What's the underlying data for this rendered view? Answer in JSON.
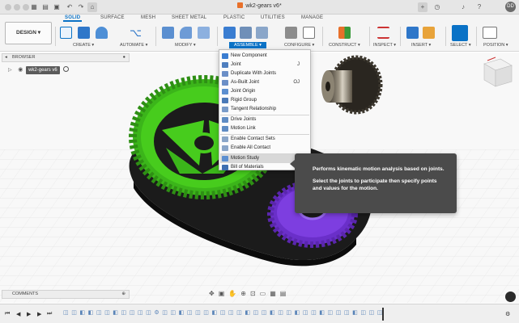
{
  "window": {
    "title": "wk2-gears v6*",
    "user_initials": "DD",
    "toolbar_icons": [
      "app-grid-icon",
      "file-icon",
      "save-icon",
      "undo-icon",
      "redo-icon",
      "home-icon",
      "new-tab-icon",
      "clock-icon",
      "bell-icon",
      "help-icon"
    ]
  },
  "tabs": [
    {
      "label": "SOLID",
      "active": true
    },
    {
      "label": "SURFACE",
      "active": false
    },
    {
      "label": "MESH",
      "active": false
    },
    {
      "label": "SHEET METAL",
      "active": false
    },
    {
      "label": "PLASTIC",
      "active": false
    },
    {
      "label": "UTILITIES",
      "active": false
    },
    {
      "label": "MANAGE",
      "active": false
    }
  ],
  "workspace": {
    "label": "DESIGN ▾"
  },
  "groups": [
    {
      "label": "CREATE ▾"
    },
    {
      "label": "AUTOMATE ▾"
    },
    {
      "label": "MODIFY ▾"
    },
    {
      "label": "ASSEMBLE ▾",
      "active": true
    },
    {
      "label": "CONFIGURE ▾"
    },
    {
      "label": "CONSTRUCT ▾"
    },
    {
      "label": "INSPECT ▾"
    },
    {
      "label": "INSERT ▾"
    },
    {
      "label": "SELECT ▾"
    },
    {
      "label": "POSITION ▾"
    }
  ],
  "browser": {
    "header": "BROWSER",
    "root_node": "wk2-gears v6"
  },
  "assemble_menu": {
    "items": [
      {
        "label": "New Component",
        "shortcut": "",
        "icon_color": "#3a7dd1"
      },
      {
        "label": "Joint",
        "shortcut": "J",
        "icon_color": "#4f7fbf"
      },
      {
        "label": "Duplicate With Joints",
        "shortcut": "",
        "icon_color": "#6b8fc7"
      },
      {
        "label": "As-Built Joint",
        "shortcut": "OJ",
        "icon_color": "#6b8fc7"
      },
      {
        "label": "Joint Origin",
        "shortcut": "",
        "icon_color": "#5c8fd0"
      },
      {
        "label": "Rigid Group",
        "shortcut": "",
        "icon_color": "#4a7ab8"
      },
      {
        "label": "Tangent Relationship",
        "shortcut": "",
        "icon_color": "#7a9cc9"
      },
      {
        "label": "Drive Joints",
        "shortcut": "",
        "icon_color": "#5f8cc4"
      },
      {
        "label": "Motion Link",
        "shortcut": "",
        "icon_color": "#5f8cc4"
      },
      {
        "label": "Enable Contact Sets",
        "shortcut": "",
        "icon_color": "#8aa6c9"
      },
      {
        "label": "Enable All Contact",
        "shortcut": "",
        "icon_color": "#8aa6c9"
      },
      {
        "label": "Motion Study",
        "shortcut": "",
        "icon_color": "#5c8fd0",
        "highlighted": true
      },
      {
        "label": "Bill of Materials",
        "shortcut": "",
        "icon_color": "#3f6fb0"
      }
    ]
  },
  "tooltip": {
    "line1": "Performs kinematic motion analysis based on joints.",
    "line2": "Select the joints to participate then specify points and values for the motion."
  },
  "comments": {
    "header": "COMMENTS"
  },
  "nav_bar": {
    "icons": [
      "orbit-icon",
      "look-at-icon",
      "pan-icon",
      "zoom-icon",
      "fit-icon",
      "display-icon",
      "grid-icon",
      "viewports-icon"
    ]
  },
  "timeline": {
    "controls": [
      "first-icon",
      "prev-icon",
      "play-icon",
      "next-icon",
      "last-icon"
    ],
    "features": "◫◫◧◧◫◫◧◫◫◫◫⚙◫◫◧◫◫◫◧◫◫◫◧◫◫◧◫◫◧◫◫◧◫◫◫◧◫◫◫◧◫◫"
  },
  "colors": {
    "accent": "#0a72c6",
    "green_gear": "#47cc1d",
    "purple_gear": "#7d3ee0",
    "base_plate": "#1b1b1b",
    "tooltip_bg": "#4b4b4b"
  }
}
